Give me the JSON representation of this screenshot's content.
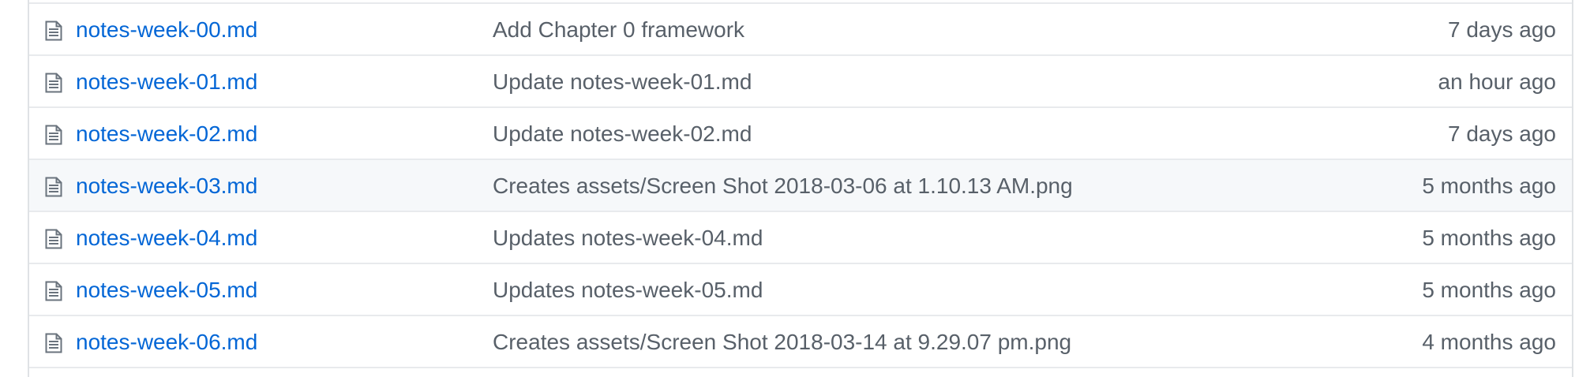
{
  "files": [
    {
      "name": "notes-week-00.md",
      "message": "Add Chapter 0 framework",
      "age": "7 days ago",
      "icon": "file-text-icon"
    },
    {
      "name": "notes-week-01.md",
      "message": "Update notes-week-01.md",
      "age": "an hour ago",
      "icon": "file-text-icon"
    },
    {
      "name": "notes-week-02.md",
      "message": "Update notes-week-02.md",
      "age": "7 days ago",
      "icon": "file-text-icon"
    },
    {
      "name": "notes-week-03.md",
      "message": "Creates assets/Screen Shot 2018-03-06 at 1.10.13 AM.png",
      "age": "5 months ago",
      "icon": "file-text-icon"
    },
    {
      "name": "notes-week-04.md",
      "message": "Updates notes-week-04.md",
      "age": "5 months ago",
      "icon": "file-text-icon"
    },
    {
      "name": "notes-week-05.md",
      "message": "Updates notes-week-05.md",
      "age": "5 months ago",
      "icon": "file-text-icon"
    },
    {
      "name": "notes-week-06.md",
      "message": "Creates assets/Screen Shot 2018-03-14 at 9.29.07 pm.png",
      "age": "4 months ago",
      "icon": "file-text-icon"
    }
  ],
  "colors": {
    "link": "#0366d6",
    "muted_text": "#586069",
    "row_hover_bg": "#f6f8fa",
    "border": "#e8eaed"
  }
}
